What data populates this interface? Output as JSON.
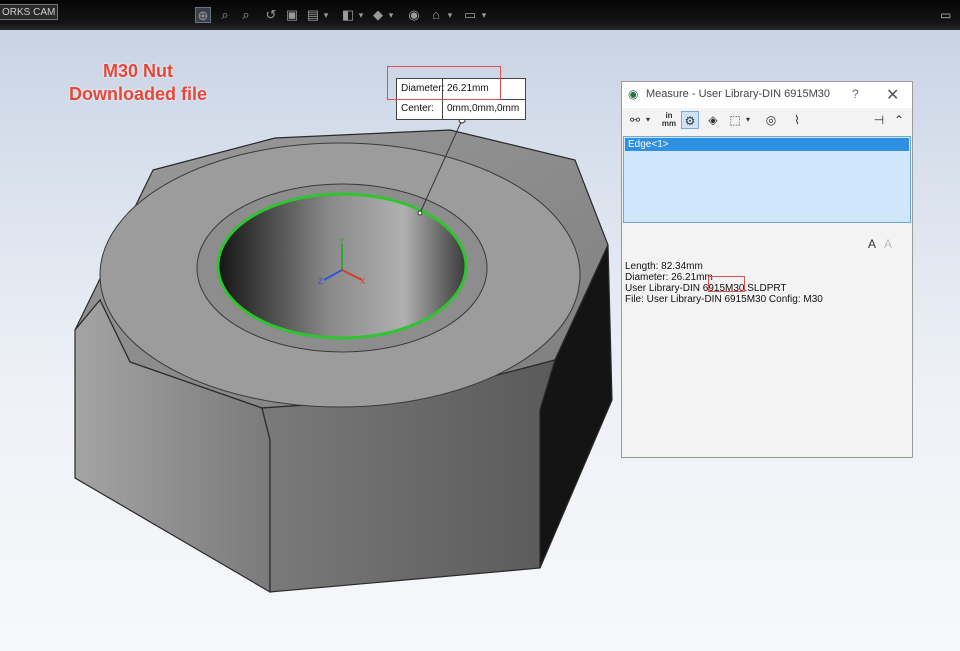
{
  "toolbar": {
    "cam_tab_label": "ORKS CAM"
  },
  "annotation": {
    "line1": "M30 Nut",
    "line2": "Downloaded file",
    "color": "#e4483b"
  },
  "callout": {
    "diameter_label": "Diameter:",
    "diameter_value": "26.21mm",
    "center_label": "Center:",
    "center_value": "0mm,0mm,0mm"
  },
  "measure_dialog": {
    "title": "Measure - User Library-DIN 6915M30",
    "help_label": "?",
    "close_label": "✕",
    "units_icon_top": "in",
    "units_icon_bottom": "mm",
    "selection_items": [
      "Edge<1>"
    ],
    "results": [
      "Length: 82.34mm",
      "Diameter: 26.21mm",
      "User Library-DIN 6915M30.SLDPRT",
      "File: User Library-DIN 6915M30 Config: M30"
    ]
  },
  "colors": {
    "edge_highlight": "#2ec52e",
    "selection_bg": "#2f8fe0",
    "list_bg": "#cfe6fb"
  }
}
